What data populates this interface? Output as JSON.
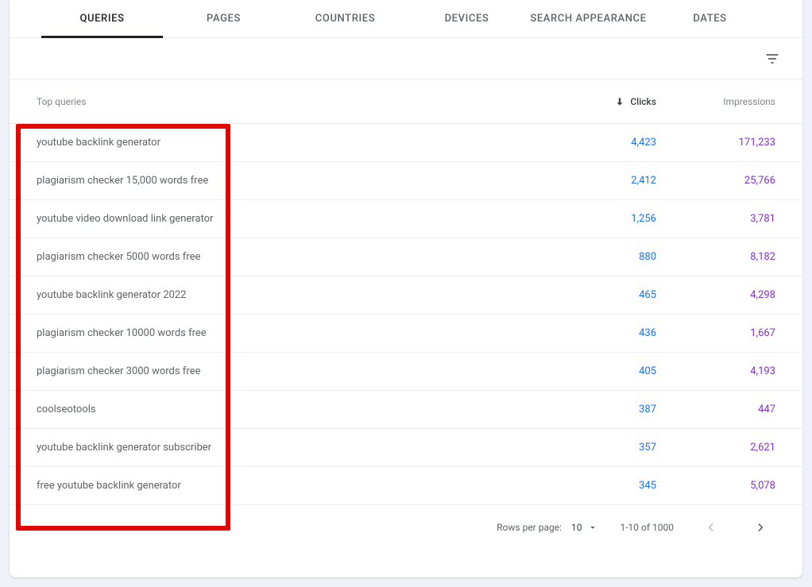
{
  "tabs": [
    "QUERIES",
    "PAGES",
    "COUNTRIES",
    "DEVICES",
    "SEARCH APPEARANCE",
    "DATES"
  ],
  "active_tab": 0,
  "columns": {
    "query": "Top queries",
    "clicks": "Clicks",
    "impressions": "Impressions"
  },
  "rows": [
    {
      "query": "youtube backlink generator",
      "clicks": "4,423",
      "impressions": "171,233"
    },
    {
      "query": "plagiarism checker 15,000 words free",
      "clicks": "2,412",
      "impressions": "25,766"
    },
    {
      "query": "youtube video download link generator",
      "clicks": "1,256",
      "impressions": "3,781"
    },
    {
      "query": "plagiarism checker 5000 words free",
      "clicks": "880",
      "impressions": "8,182"
    },
    {
      "query": "youtube backlink generator 2022",
      "clicks": "465",
      "impressions": "4,298"
    },
    {
      "query": "plagiarism checker 10000 words free",
      "clicks": "436",
      "impressions": "1,667"
    },
    {
      "query": "plagiarism checker 3000 words free",
      "clicks": "405",
      "impressions": "4,193"
    },
    {
      "query": "coolseotools",
      "clicks": "387",
      "impressions": "447"
    },
    {
      "query": "youtube backlink generator subscriber",
      "clicks": "357",
      "impressions": "2,621"
    },
    {
      "query": "free youtube backlink generator",
      "clicks": "345",
      "impressions": "5,078"
    }
  ],
  "pagination": {
    "rows_per_page_label": "Rows per page:",
    "rows_per_page": "10",
    "range": "1-10 of 1000"
  }
}
